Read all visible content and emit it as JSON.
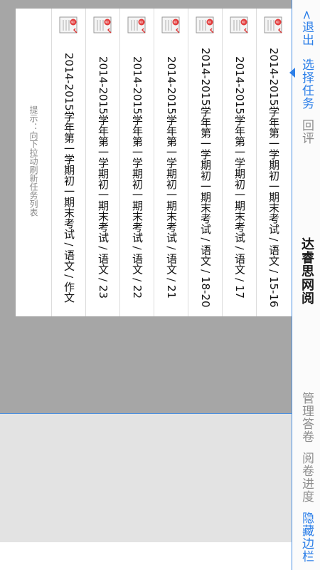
{
  "header": {
    "back_label": "<退出",
    "tabs": [
      {
        "label": "选择任务",
        "active": true
      },
      {
        "label": "回评",
        "active": false
      }
    ],
    "title": "达睿思网阅"
  },
  "sidebar_bottom": {
    "items": [
      {
        "label": "管理答卷"
      },
      {
        "label": "阅卷进度"
      },
      {
        "label": "隐藏边栏"
      }
    ]
  },
  "tasks": [
    {
      "label": "2014-2015学年第一学期初一期末考试 / 语文 / 15-16",
      "icon": "exam-paper-icon"
    },
    {
      "label": "2014-2015学年第一学期初一期末考试 / 语文 / 17",
      "icon": "exam-paper-icon"
    },
    {
      "label": "2014-2015学年第一学期初一期末考试 / 语文 / 18-20",
      "icon": "exam-paper-icon"
    },
    {
      "label": "2014-2015学年第一学期初一期末考试 / 语文 / 21",
      "icon": "exam-paper-icon"
    },
    {
      "label": "2014-2015学年第一学期初一期末考试 / 语文 / 22",
      "icon": "exam-paper-icon"
    },
    {
      "label": "2014-2015学年第一学期初一期末考试 / 语文 / 23",
      "icon": "exam-paper-icon"
    },
    {
      "label": "2014-2015学年第一学期初一期末考试 / 语文 / 作文",
      "icon": "exam-paper-icon"
    }
  ],
  "hint": "提示：向下拉动刷新任务列表",
  "colors": {
    "accent": "#2c7fe8",
    "backdrop": "#a6a6a6",
    "panel": "#e3e3e3"
  }
}
